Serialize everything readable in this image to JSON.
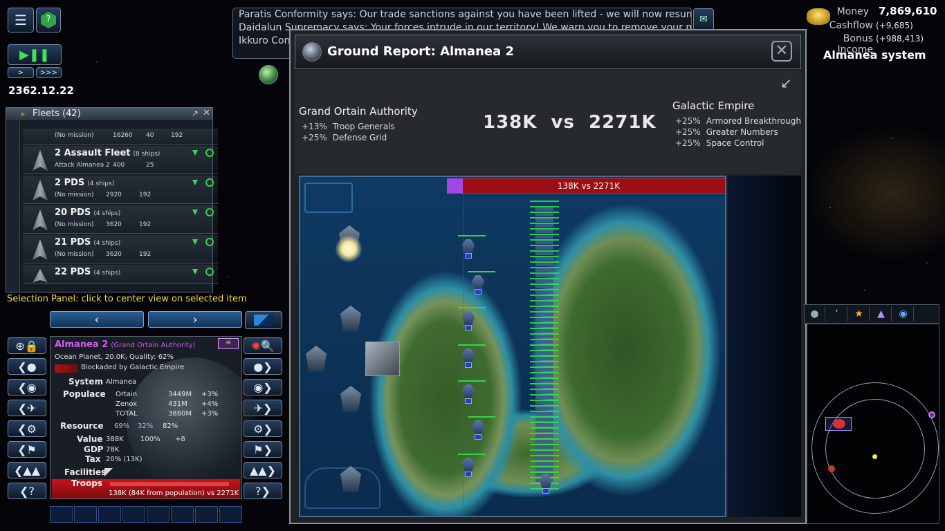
{
  "top_left": {
    "date": "2362.12.22",
    "menu_icon": "menu-icon",
    "help_icon": "help-icon",
    "play_pause_icon": "play-pause-icon",
    "speed_normal": ">",
    "speed_fast": ">>>"
  },
  "messages": {
    "lines": [
      "Paratis Conformity says: Our trade sanctions against you have been lifted - we will now resume trade.",
      "Daidalun Supremacy says: Your forces intrude in our territory! We warn you to remove your military ship",
      "Ikkuro Conf"
    ]
  },
  "economy": {
    "money_label": "Money",
    "money_value": "7,869,610",
    "cashflow_label": "Cashflow",
    "cashflow_value": "(+9,685)",
    "bonus_label": "Bonus Income",
    "bonus_value": "(+988,413)",
    "system_name": "Almanea system"
  },
  "fleets": {
    "title": "Fleets (42)",
    "rows": [
      {
        "name": "",
        "ships": "",
        "mission": "(No mission)",
        "fuel": "16260",
        "s2": "40",
        "s3": "192"
      },
      {
        "name": "2 Assault Fleet",
        "ships": "(8 ships)",
        "mission": "Attack Almanea 2",
        "fuel": "400",
        "s2": "25",
        "s3": ""
      },
      {
        "name": "2 PDS",
        "ships": "(4 ships)",
        "mission": "(No mission)",
        "fuel": "2920",
        "s2": "",
        "s3": "192"
      },
      {
        "name": "20 PDS",
        "ships": "(4 ships)",
        "mission": "(No mission)",
        "fuel": "3620",
        "s2": "",
        "s3": "192"
      },
      {
        "name": "21 PDS",
        "ships": "(4 ships)",
        "mission": "(No mission)",
        "fuel": "3620",
        "s2": "",
        "s3": "192"
      },
      {
        "name": "22 PDS",
        "ships": "(4 ships)",
        "mission": "",
        "fuel": "",
        "s2": "",
        "s3": ""
      }
    ]
  },
  "selection_hint": "Selection Panel: click to center view on selected item",
  "planet": {
    "name": "Almanea 2",
    "owner": "(Grand Ortain Authority)",
    "summary": "Ocean Planet, 20.0K, Quality: 62%",
    "blockade": "Blockaded by Galactic Empire",
    "system_label": "System",
    "system_value": "Almanea",
    "populace_label": "Populace",
    "populace": [
      {
        "race": "Ortain",
        "amount": "3449M",
        "growth": "+3%"
      },
      {
        "race": "Zenox",
        "amount": "431M",
        "growth": "+4%"
      },
      {
        "race": "TOTAL",
        "amount": "3880M",
        "growth": "+3%"
      }
    ],
    "resource_label": "Resource",
    "resources": [
      "69%",
      "32%",
      "82%"
    ],
    "value_label": "Value",
    "value_amount": "388K",
    "value_pct": "100%",
    "value_bonus": "+8",
    "gdp_label": "GDP",
    "gdp_value": "78K",
    "tax_label": "Tax",
    "tax_value": "20% (13K)",
    "facilities_label": "Facilities",
    "troops_label": "Troops",
    "troops_value": "138K (84K from population)  vs  2271K"
  },
  "ground_report": {
    "title": "Ground Report: Almanea 2",
    "close_icon": "close-icon",
    "attacker": {
      "name": "Grand Ortain Authority",
      "bonuses": [
        {
          "pct": "+13%",
          "label": "Troop Generals"
        },
        {
          "pct": "+25%",
          "label": "Defense Grid"
        }
      ]
    },
    "defender": {
      "name": "Galactic Empire",
      "bonuses": [
        {
          "pct": "+25%",
          "label": "Armored Breakthrough"
        },
        {
          "pct": "+25%",
          "label": "Greater Numbers"
        },
        {
          "pct": "+25%",
          "label": "Space Control"
        }
      ]
    },
    "versus": "138K  vs  2271K",
    "battle_bar": "138K vs 2271K",
    "battle_bar_fraction": 0.057,
    "colors": {
      "ours": "#a246e8",
      "theirs": "#9b0f14"
    }
  }
}
